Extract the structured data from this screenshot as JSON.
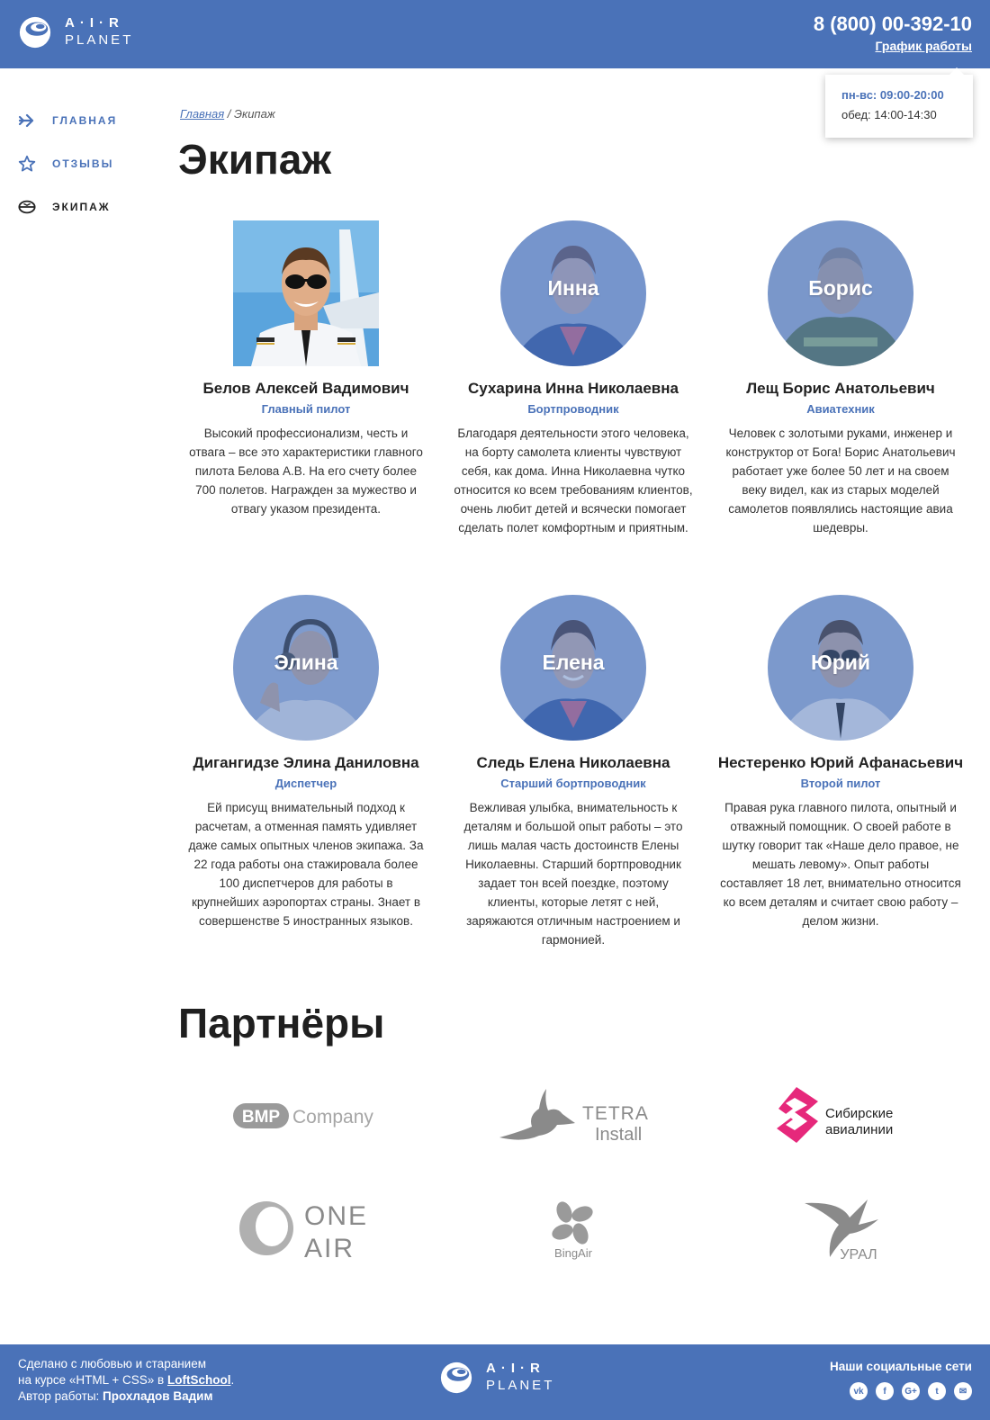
{
  "header": {
    "logo_line1": "A·I·R",
    "logo_line2": "PLANET",
    "phone": "8 (800) 00-392-10",
    "schedule_link": "График работы",
    "schedule_hours": "пн-вс: 09:00-20:00",
    "schedule_lunch": "обед: 14:00-14:30"
  },
  "sidebar": {
    "items": [
      {
        "label": "ГЛАВНАЯ",
        "icon": "arrow-right-icon"
      },
      {
        "label": "ОТЗЫВЫ",
        "icon": "star-icon"
      },
      {
        "label": "ЭКИПАЖ",
        "icon": "pilot-cap-icon"
      }
    ]
  },
  "breadcrumb": {
    "home": "Главная",
    "separator": " / ",
    "current": "Экипаж"
  },
  "page_title": "Экипаж",
  "crew": [
    {
      "first": "",
      "name": "Белов Алексей Вадимович",
      "role": "Главный пилот",
      "desc": "Высокий профессионализм, честь и отвага – все это характеристики главного пилота Белова А.В. На его счету более 700 полетов. Награжден за мужество и отвагу указом президента."
    },
    {
      "first": "Инна",
      "name": "Сухарина Инна Николаевна",
      "role": "Бортпроводник",
      "desc": "Благодаря деятельности этого человека, на борту самолета клиенты чувствуют себя, как дома. Инна Николаевна чутко относится ко всем требованиям клиентов, очень любит детей и всячески помогает сделать полет комфортным и приятным."
    },
    {
      "first": "Борис",
      "name": "Лещ Борис Анатольевич",
      "role": "Авиатехник",
      "desc": "Человек с золотыми руками, инженер и конструктор от Бога! Борис Анатольевич работает уже более 50 лет и на своем веку видел, как из старых моделей самолетов появлялись настоящие авиа шедевры."
    },
    {
      "first": "Элина",
      "name": "Дигангидзе Элина Даниловна",
      "role": "Диспетчер",
      "desc": "Ей присущ внимательный подход к расчетам, а отменная память удивляет даже самых опытных членов экипажа. За 22 года работы она стажировала более 100 диспетчеров для работы в крупнейших аэропортах страны.  Знает в совершенстве 5 иностранных языков."
    },
    {
      "first": "Елена",
      "name": "Следь Елена Николаевна",
      "role": "Старший бортпроводник",
      "desc": "Вежливая улыбка, внимательность к деталям и большой опыт работы – это лишь малая часть достоинств Елены Николаевны. Старший бортпроводник задает тон всей поездке, поэтому клиенты, которые летят с ней, заряжаются отличным настроением и гармонией."
    },
    {
      "first": "Юрий",
      "name": "Нестеренко Юрий Афанасьевич",
      "role": "Второй пилот",
      "desc": "Правая рука главного пилота, опытный и отважный помощник. О своей работе в шутку говорит так «Наше дело правое, не мешать левому». Опыт работы составляет 18 лет, внимательно относится ко всем деталям и считает свою работу – делом жизни."
    }
  ],
  "partners_title": "Партнёры",
  "partners": {
    "bmp": {
      "badge": "BMP",
      "word": "Company"
    },
    "tetra": {
      "line1": "TETRA",
      "line2": "Install"
    },
    "sibir": {
      "line1": "Сибирские",
      "line2": "авиалинии"
    },
    "oneair": {
      "line1": "ONE",
      "line2": "AIR"
    },
    "bingair": {
      "label": "BingAir"
    },
    "ural": {
      "label": "УРАЛ"
    }
  },
  "footer": {
    "line1": "Сделано с любовью и старанием",
    "line2_prefix": "на курсе «HTML + CSS» в ",
    "line2_link": "LoftSchool",
    "line2_suffix": ".",
    "line3_prefix": "Автор работы: ",
    "line3_author": "Прохладов Вадим",
    "social_title": "Наши социальные сети",
    "social": [
      {
        "icon": "vk-icon",
        "glyph": "vk"
      },
      {
        "icon": "facebook-icon",
        "glyph": "f"
      },
      {
        "icon": "google-plus-icon",
        "glyph": "G+"
      },
      {
        "icon": "twitter-icon",
        "glyph": "t"
      },
      {
        "icon": "mail-icon",
        "glyph": "✉"
      }
    ]
  },
  "colors": {
    "brand": "#4a72b8",
    "title": "#1f1f1f",
    "text": "#333333",
    "accent_pink": "#e6287b"
  }
}
